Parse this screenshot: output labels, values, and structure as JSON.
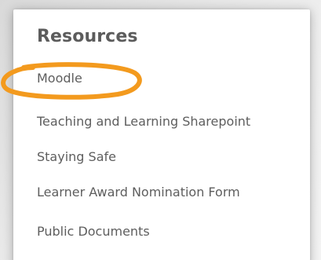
{
  "panel": {
    "title": "Resources",
    "links": [
      {
        "label": "Moodle"
      },
      {
        "label": "Teaching and Learning Sharepoint"
      },
      {
        "label": "Staying Safe"
      },
      {
        "label": "Learner Award Nomination Form"
      },
      {
        "label": "Public Documents"
      }
    ]
  },
  "colors": {
    "highlight": "#f39a1e",
    "title": "#5c5c5c",
    "link": "#5e5e5e",
    "card_background": "#ffffff"
  },
  "annotation": {
    "shape": "ellipse",
    "target": "Moodle"
  }
}
